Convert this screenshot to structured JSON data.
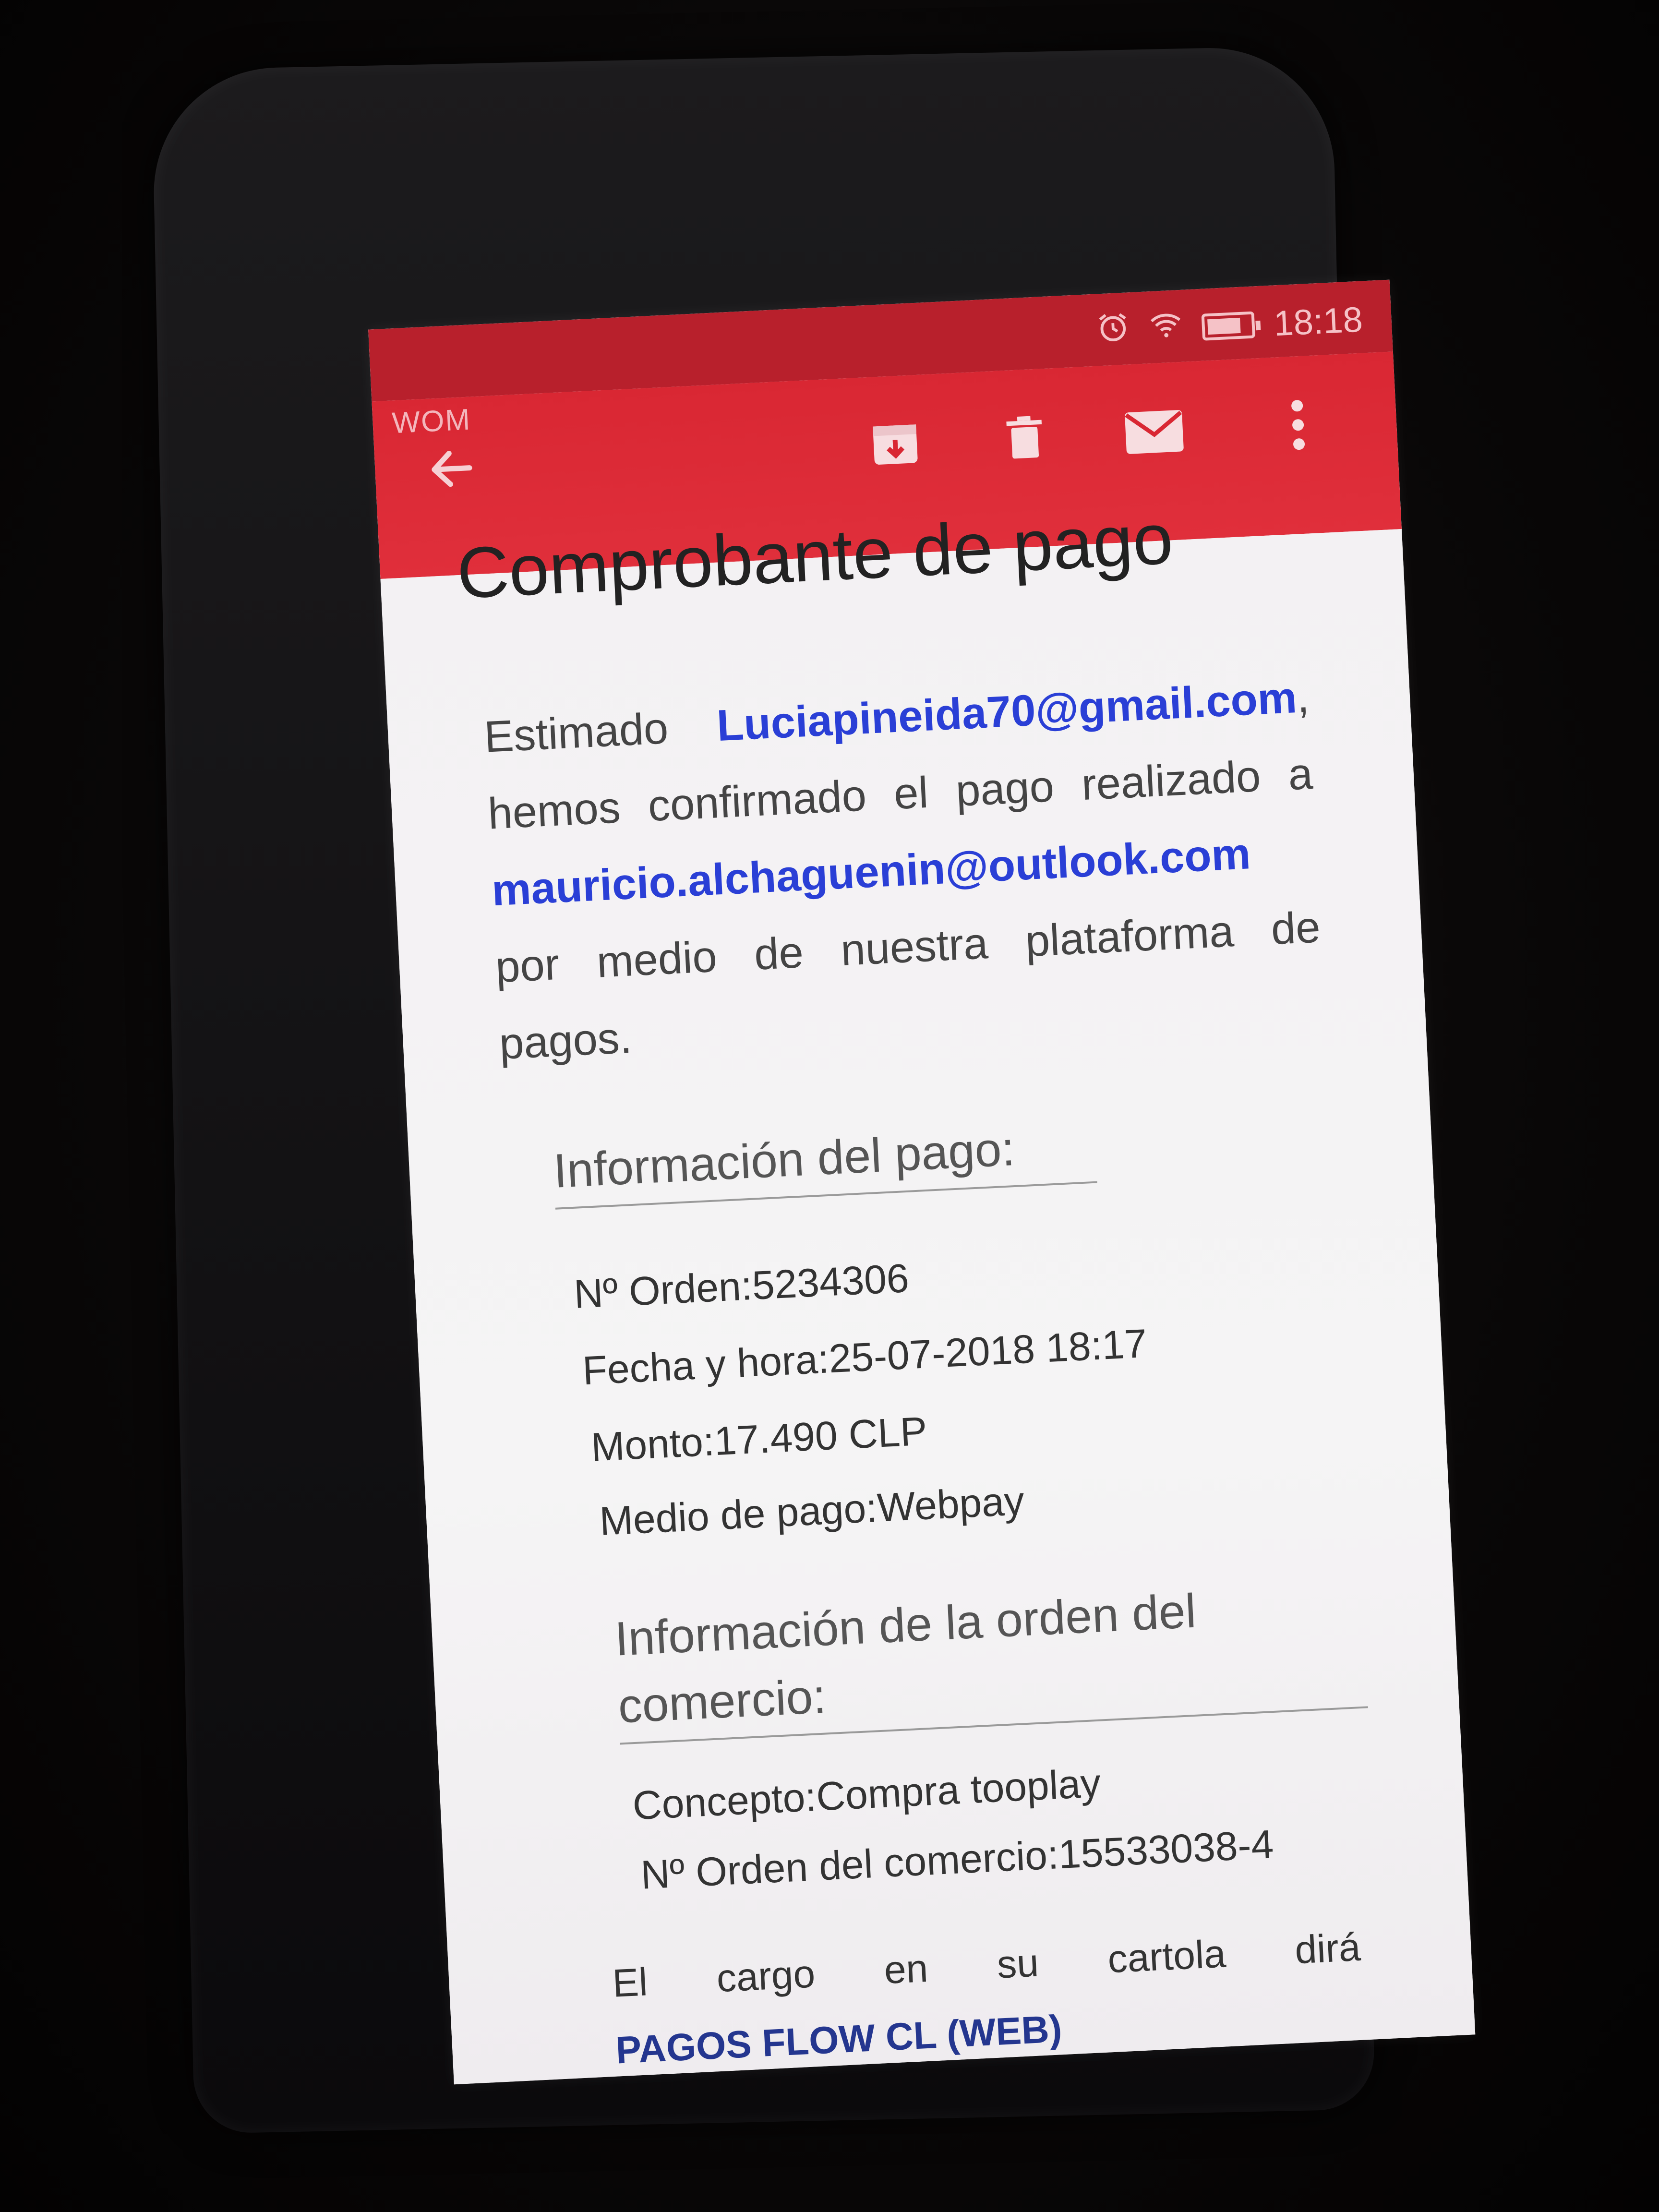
{
  "status_bar": {
    "carrier": "WOM",
    "time": "18:18"
  },
  "toolbar": {
    "back_icon": "arrow-left-icon",
    "archive_icon": "archive-icon",
    "delete_icon": "trash-icon",
    "mark_unread_icon": "envelope-icon",
    "more_icon": "more-vert-icon",
    "color": "#e02f3b"
  },
  "email": {
    "subject": "Comprobante de pago",
    "greeting": "Estimado",
    "recipient": "Luciapineida70@gmail.com",
    "comma": ",",
    "body_1": "hemos confirmado el pago realizado a",
    "payee": "mauricio.alchaguenin@outlook.com",
    "body_2": "por medio de nuestra plataforma de pagos."
  },
  "payment_info": {
    "title": "Información del pago:",
    "order_number": "Nº Orden:5234306",
    "datetime": "Fecha y hora:25-07-2018 18:17",
    "amount": "Monto:17.490 CLP",
    "payment_method": "Medio de pago:Webpay"
  },
  "merchant_info": {
    "title": "Información de la orden del comercio:",
    "concept": "Concepto:Compra tooplay",
    "merchant_order": "Nº Orden del comercio:15533038-4"
  },
  "footer": {
    "words": [
      "El",
      "cargo",
      "en",
      "su",
      "cartola",
      "dirá"
    ],
    "statement_name": "PAGOS FLOW CL (WEB)"
  }
}
